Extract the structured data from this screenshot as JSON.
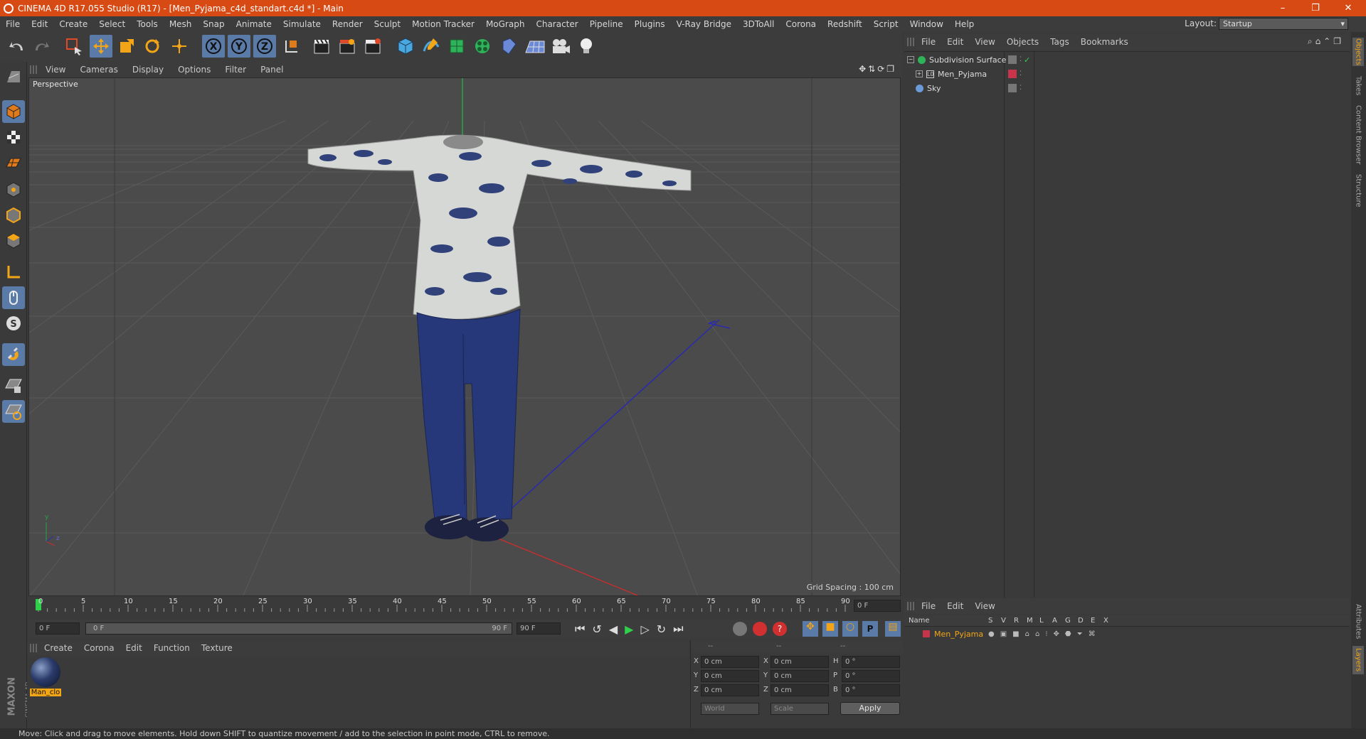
{
  "window": {
    "title": "CINEMA 4D R17.055 Studio (R17) - [Men_Pyjama_c4d_standart.c4d *] - Main",
    "controls": [
      "–",
      "❐",
      "✕"
    ]
  },
  "menubar": {
    "items": [
      "File",
      "Edit",
      "Create",
      "Select",
      "Tools",
      "Mesh",
      "Snap",
      "Animate",
      "Simulate",
      "Render",
      "Sculpt",
      "Motion Tracker",
      "MoGraph",
      "Character",
      "Pipeline",
      "Plugins",
      "V-Ray Bridge",
      "3DToAll",
      "Corona",
      "Redshift",
      "Script",
      "Window",
      "Help"
    ],
    "layout_label": "Layout:",
    "layout_value": "Startup"
  },
  "viewport": {
    "menu": [
      "View",
      "Cameras",
      "Display",
      "Options",
      "Filter",
      "Panel"
    ],
    "camera_label": "Perspective",
    "grid_spacing": "Grid Spacing : 100 cm"
  },
  "timeline": {
    "ticks": [
      "0",
      "5",
      "10",
      "15",
      "20",
      "25",
      "30",
      "35",
      "40",
      "45",
      "50",
      "55",
      "60",
      "65",
      "70",
      "75",
      "80",
      "85",
      "90"
    ],
    "current_frame": "0 F",
    "start_field": "0 F",
    "range_start": "0 F",
    "range_end": "90 F",
    "end_field": "90 F"
  },
  "material_manager": {
    "menu": [
      "Create",
      "Corona",
      "Edit",
      "Function",
      "Texture"
    ],
    "materials": [
      {
        "name": "Man_clo"
      }
    ]
  },
  "coordinates": {
    "headers": [
      "--",
      "--",
      "--"
    ],
    "rows": [
      {
        "a_label": "X",
        "a_val": "0 cm",
        "b_label": "X",
        "b_val": "0 cm",
        "c_label": "H",
        "c_val": "0 °"
      },
      {
        "a_label": "Y",
        "a_val": "0 cm",
        "b_label": "Y",
        "b_val": "0 cm",
        "c_label": "P",
        "c_val": "0 °"
      },
      {
        "a_label": "Z",
        "a_val": "0 cm",
        "b_label": "Z",
        "b_val": "0 cm",
        "c_label": "B",
        "c_val": "0 °"
      }
    ],
    "world": "World",
    "scale": "Scale",
    "apply": "Apply"
  },
  "object_manager": {
    "menu": [
      "File",
      "Edit",
      "View",
      "Objects",
      "Tags",
      "Bookmarks"
    ],
    "objects": [
      {
        "name": "Subdivision Surface"
      },
      {
        "name": "Men_Pyjama"
      },
      {
        "name": "Sky"
      }
    ]
  },
  "attributes": {
    "menu": [
      "File",
      "Edit",
      "View"
    ],
    "columns": [
      "Name",
      "S",
      "V",
      "R",
      "M",
      "L",
      "A",
      "G",
      "D",
      "E",
      "X"
    ],
    "layer_name": "Men_Pyjama"
  },
  "right_tabs": [
    "Objects",
    "Takes",
    "Content Browser",
    "Structure",
    "Attributes",
    "Layers"
  ],
  "brand": [
    "MAXON",
    "CINEMA 4D"
  ],
  "status": "Move: Click and drag to move elements. Hold down SHIFT to quantize movement / add to the selection in point mode, CTRL to remove."
}
